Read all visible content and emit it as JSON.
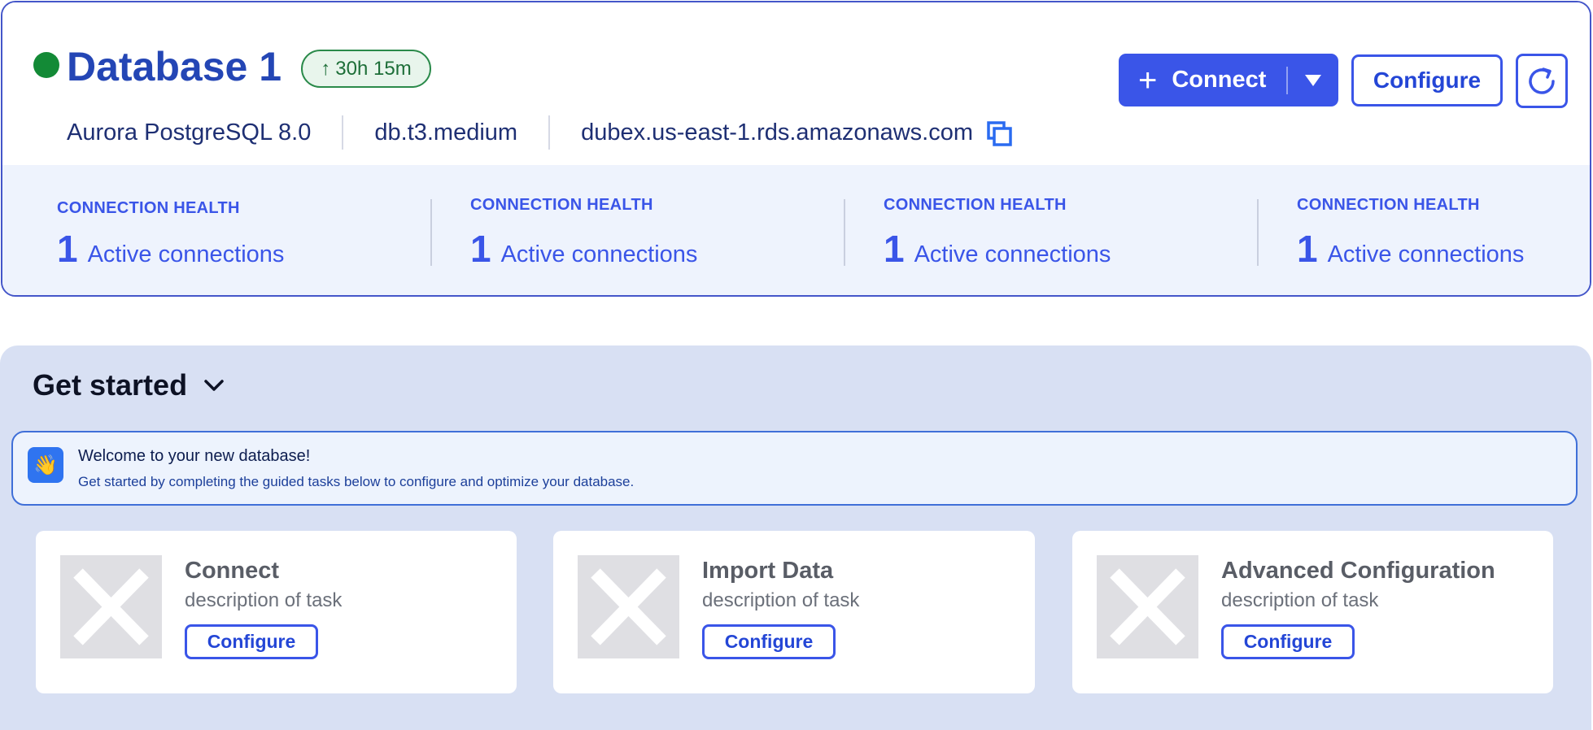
{
  "header": {
    "status_color": "#138a36",
    "title": "Database 1",
    "uptime": "30h 15m",
    "engine": "Aurora PostgreSQL 8.0",
    "instance_class": "db.t3.medium",
    "endpoint": "dubex.us-east-1.rds.amazonaws.com",
    "actions": {
      "connect_label": "Connect",
      "configure_label": "Configure"
    }
  },
  "health": [
    {
      "label": "CONNECTION HEALTH",
      "value": "1",
      "text": "Active connections"
    },
    {
      "label": "CONNECTION HEALTH",
      "value": "1",
      "text": "Active connections"
    },
    {
      "label": "CONNECTION HEALTH",
      "value": "1",
      "text": "Active connections"
    },
    {
      "label": "CONNECTION HEALTH",
      "value": "1",
      "text": "Active connections"
    }
  ],
  "get_started": {
    "title": "Get started",
    "welcome": {
      "icon": "waving-hand-icon",
      "title": "Welcome to your new database!",
      "subtitle": "Get started by completing the guided tasks below to configure and optimize your database."
    },
    "tasks": [
      {
        "title": "Connect",
        "description": "description of task",
        "button": "Configure"
      },
      {
        "title": "Import Data",
        "description": "description of task",
        "button": "Configure"
      },
      {
        "title": "Advanced Configuration",
        "description": "description of task",
        "button": "Configure"
      }
    ]
  },
  "colors": {
    "primary": "#3a55e8",
    "title_blue": "#2446b5",
    "success": "#138a36",
    "panel_bg": "#d8e0f3",
    "health_bg": "#eef3fd"
  }
}
